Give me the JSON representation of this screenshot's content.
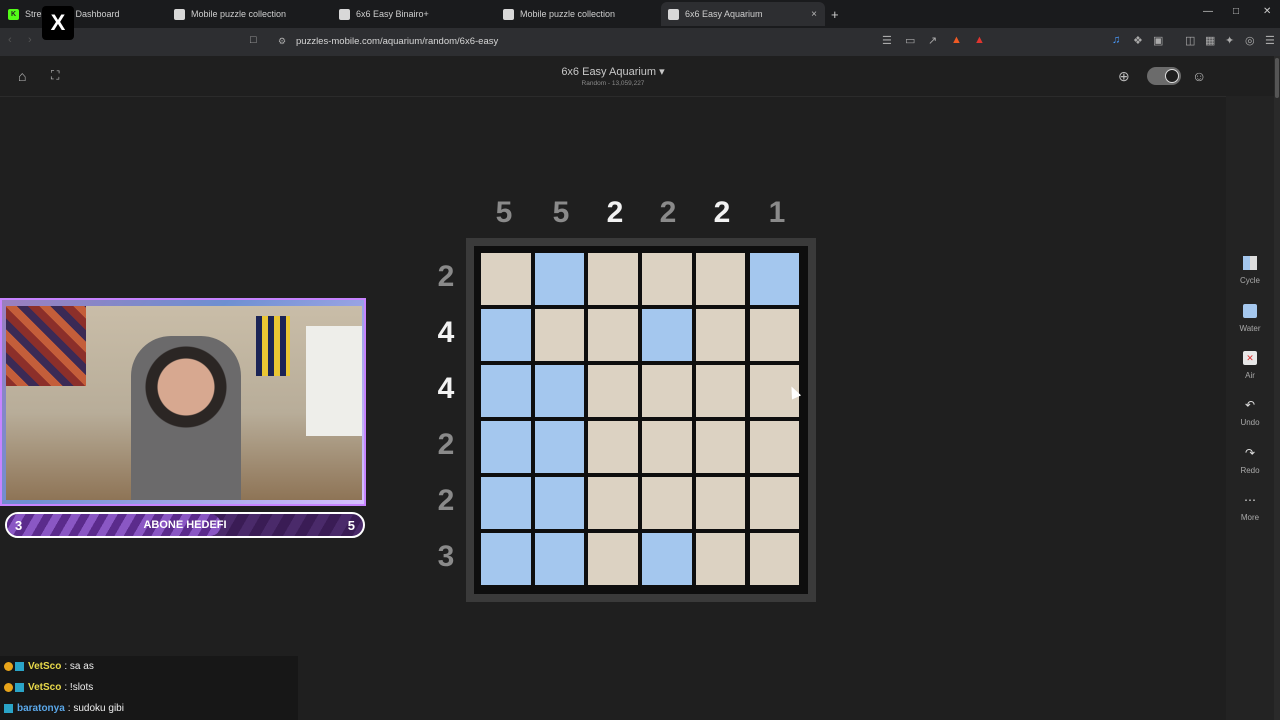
{
  "browser": {
    "tabs": [
      {
        "label": "Stre",
        "extra": "Dashboard",
        "fav_color": "#53fc18"
      },
      {
        "label": "Mobile puzzle collection",
        "fav_color": "#d8d8d8"
      },
      {
        "label": "6x6 Easy Binairo+",
        "fav_color": "#d8d8d8"
      },
      {
        "label": "Mobile puzzle collection",
        "fav_color": "#d8d8d8"
      },
      {
        "label": "6x6 Easy Aquarium",
        "fav_color": "#d8d8d8",
        "active": true
      }
    ],
    "url": "puzzles-mobile.com/aquarium/random/6x6-easy",
    "new_tab": "+",
    "close": "×"
  },
  "page": {
    "title": "6x6 Easy Aquarium ▾",
    "subtitle": "Random - 13,059,227"
  },
  "toolbar": [
    {
      "label": "Cycle",
      "icon": "cycle-icon"
    },
    {
      "label": "Water",
      "icon": "water-icon"
    },
    {
      "label": "Air",
      "icon": "air-icon"
    },
    {
      "label": "Undo",
      "icon": "undo-icon"
    },
    {
      "label": "Redo",
      "icon": "redo-icon"
    },
    {
      "label": "More",
      "icon": "more-icon"
    }
  ],
  "puzzle": {
    "col_clues": [
      {
        "v": "5",
        "done": true
      },
      {
        "v": "5",
        "done": true
      },
      {
        "v": "2",
        "done": false
      },
      {
        "v": "2",
        "done": true
      },
      {
        "v": "2",
        "done": false
      },
      {
        "v": "1",
        "done": true
      }
    ],
    "row_clues": [
      {
        "v": "2",
        "done": true
      },
      {
        "v": "4",
        "done": false
      },
      {
        "v": "4",
        "done": false
      },
      {
        "v": "2",
        "done": true
      },
      {
        "v": "2",
        "done": true
      },
      {
        "v": "3",
        "done": true
      }
    ],
    "grid": [
      [
        "e",
        "w",
        "e",
        "e",
        "e",
        "w"
      ],
      [
        "w",
        "e",
        "e",
        "w",
        "e",
        "e"
      ],
      [
        "w",
        "w",
        "e",
        "e",
        "e",
        "e"
      ],
      [
        "w",
        "w",
        "e",
        "e",
        "e",
        "e"
      ],
      [
        "w",
        "w",
        "e",
        "e",
        "e",
        "e"
      ],
      [
        "w",
        "w",
        "e",
        "w",
        "e",
        "e"
      ]
    ],
    "colors": {
      "water": "#a4c7ee",
      "empty": "#dcd2c2",
      "clue_done": "#8a8a8a",
      "clue_active": "#f2f2f2"
    }
  },
  "stream": {
    "goal_label": "ABONE HEDEFI",
    "goal_current": "3",
    "goal_target": "5",
    "goal_progress": 0.6,
    "chat": [
      {
        "user": "VetSco",
        "text": ": sa as",
        "color": "#e8d94a"
      },
      {
        "user": "VetSco",
        "text": ": !slots",
        "color": "#e8d94a"
      },
      {
        "user": "baratonya",
        "text": ": sudoku gibi",
        "color": "#5aa7e8"
      }
    ]
  }
}
